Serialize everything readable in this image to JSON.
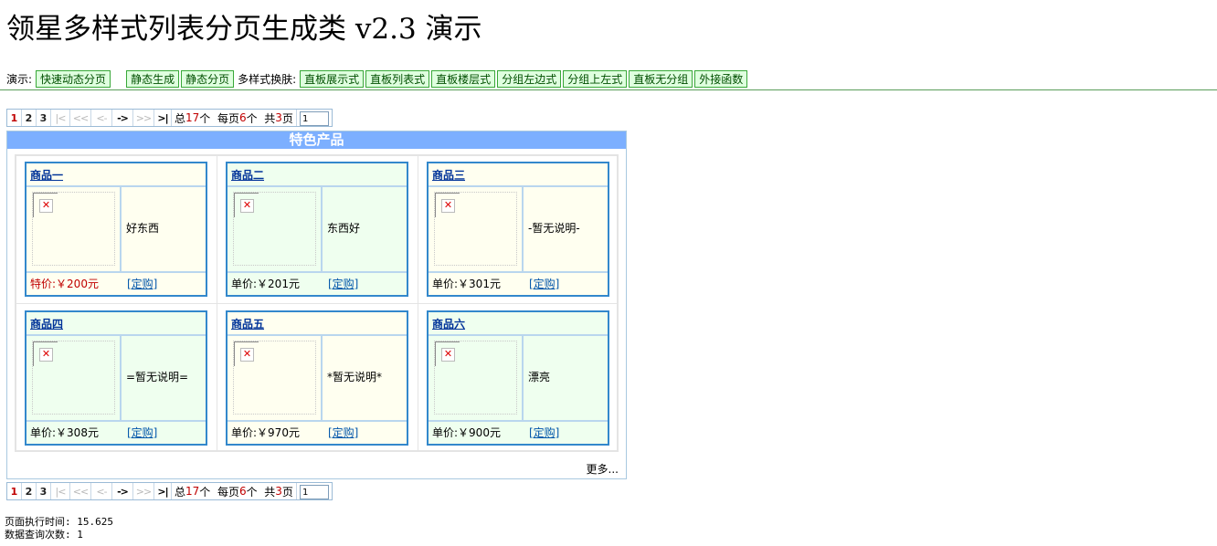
{
  "page": {
    "title": "领星多样式列表分页生成类 v2.3 演示"
  },
  "nav": {
    "demo_label": "演示:",
    "fast_dynamic": "快速动态分页",
    "static_gen": "静态生成",
    "static_page": "静态分页",
    "skin_label": "多样式换肤:",
    "skins": [
      "直板展示式",
      "直板列表式",
      "直板楼层式",
      "分组左边式",
      "分组上左式",
      "直板无分组",
      "外接函数"
    ]
  },
  "pager": {
    "pages": [
      "1",
      "2",
      "3"
    ],
    "current": "1",
    "first": "|<",
    "prev_dbl": "<<",
    "prev": "<-",
    "next": "->",
    "next_dbl": ">>",
    "last": ">|",
    "total_prefix": "总",
    "total": "17",
    "total_suffix": "个",
    "per_prefix": "每页",
    "per": "6",
    "per_suffix": "个",
    "pages_prefix": "共",
    "page_count": "3",
    "pages_suffix": "页",
    "input_value": "1"
  },
  "panel": {
    "title": "特色产品",
    "more": "更多...",
    "products": [
      {
        "name": "商品一",
        "desc": "好东西",
        "price": "特价:￥200元",
        "order": "[定购]"
      },
      {
        "name": "商品二",
        "desc": "东西好",
        "price": "单价:￥201元",
        "order": "[定购]"
      },
      {
        "name": "商品三",
        "desc": "-暂无说明-",
        "price": "单价:￥301元",
        "order": "[定购]"
      },
      {
        "name": "商品四",
        "desc": "=暂无说明=",
        "price": "单价:￥308元",
        "order": "[定购]"
      },
      {
        "name": "商品五",
        "desc": "*暂无说明*",
        "price": "单价:￥970元",
        "order": "[定购]"
      },
      {
        "name": "商品六",
        "desc": "漂亮",
        "price": "单价:￥900元",
        "order": "[定购]"
      }
    ]
  },
  "footer": {
    "exec_time": "页面执行时间: 15.625",
    "queries": "数据查询次数: 1"
  }
}
